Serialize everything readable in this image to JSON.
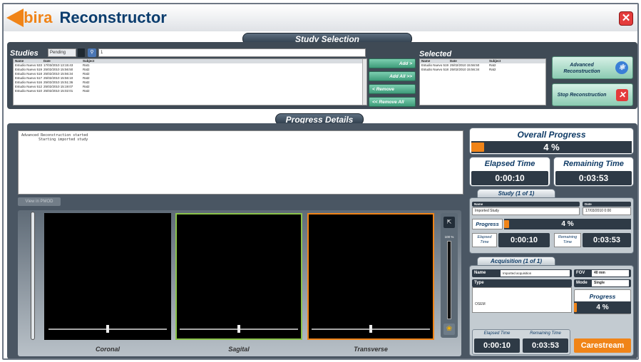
{
  "app": {
    "logo_letter": "A",
    "name_fragment": "lbira",
    "title": "Reconstructor",
    "close_glyph": "✕"
  },
  "study_selection": {
    "section_title": "Study Selection",
    "studies_label": "Studies",
    "filter_value": "Pending",
    "search_value": "1",
    "studies_table": {
      "headers": [
        "Name",
        "Date",
        "Subject"
      ],
      "rows": [
        [
          "Estudio Nuevo 533",
          "17/03/2010 13:15:43",
          "Rat1"
        ],
        [
          "Estudio Nuevo 519",
          "25/02/2010 15:56:50",
          "Rat2"
        ],
        [
          "Estudio Nuevo 518",
          "25/02/2010 15:56:34",
          "Rat2"
        ],
        [
          "Estudio Nuevo 517",
          "25/02/2010 15:56:10",
          "Rat2"
        ],
        [
          "Estudio Nuevo 516",
          "25/02/2010 15:51:36",
          "Rat2"
        ],
        [
          "Estudio Nuevo 512",
          "25/02/2010 15:19:07",
          "Rat2"
        ],
        [
          "Estudio Nuevo 510",
          "25/02/2010 15:02:01",
          "Rat2"
        ]
      ]
    },
    "buttons": {
      "add": "Add >",
      "add_all": "Add All >>",
      "remove": "< Remove",
      "remove_all": "<< Remove All"
    },
    "selected_label": "Selected",
    "selected_table": {
      "headers": [
        "Name",
        "Date",
        "Subject"
      ],
      "rows": [
        [
          "Estudio Nuevo 519",
          "25/02/2010 15:56:50",
          "Rat2"
        ],
        [
          "Estudio Nuevo 518",
          "25/02/2010 15:56:34",
          "Rat2"
        ]
      ]
    },
    "advanced_btn": "Advanced Reconstruction",
    "stop_btn": "Stop Reconstruction"
  },
  "progress_details": {
    "section_title": "Progress Details",
    "log_text": "Advanced Reconstruction started\n        Starting imported study",
    "view_pmod": "View in PMOD",
    "viewers": [
      {
        "label": "Coronal",
        "border_color": "#000000",
        "thumb_pct": 0.5
      },
      {
        "label": "Sagital",
        "border_color": "#8bc34a",
        "thumb_pct": 0.5
      },
      {
        "label": "Transverse",
        "border_color": "#f08418",
        "thumb_pct": 0.5
      }
    ],
    "zoom_label": "100 %"
  },
  "overall": {
    "label": "Overall Progress",
    "value": "4 %",
    "fraction": 0.04,
    "elapsed_label": "Elapsed Time",
    "elapsed": "0:00:10",
    "remaining_label": "Remaining Time",
    "remaining": "0:03:53"
  },
  "study": {
    "header": "Study (1 of 1)",
    "name_label": "Name",
    "name_value": "Imported Study",
    "date_label": "Date",
    "date_value": "17/03/2010 0:00",
    "progress_label": "Progress",
    "progress_value": "4 %",
    "elapsed_label": "Elapsed Time",
    "elapsed": "0:00:10",
    "remaining_label": "Remaining Time",
    "remaining": "0:03:53"
  },
  "acquisition": {
    "header": "Acquisition (1 of 1)",
    "name_label": "Name",
    "name_value": "Imported acquisition",
    "fov_label": "FOV",
    "fov_value": "40 mm",
    "type_label": "Type",
    "type_value": "OSEM",
    "mode_label": "Mode",
    "mode_value": "Single",
    "progress_label": "Progress",
    "progress_value": "4 %",
    "elapsed_label": "Elapsed Time",
    "elapsed": "0:00:10",
    "remaining_label": "Remaining Time",
    "remaining": "0:03:53"
  },
  "brand": "Carestream",
  "colors": {
    "accent": "#f08418",
    "brand_blue": "#0b3d6e",
    "panel": "#3f4a55"
  }
}
